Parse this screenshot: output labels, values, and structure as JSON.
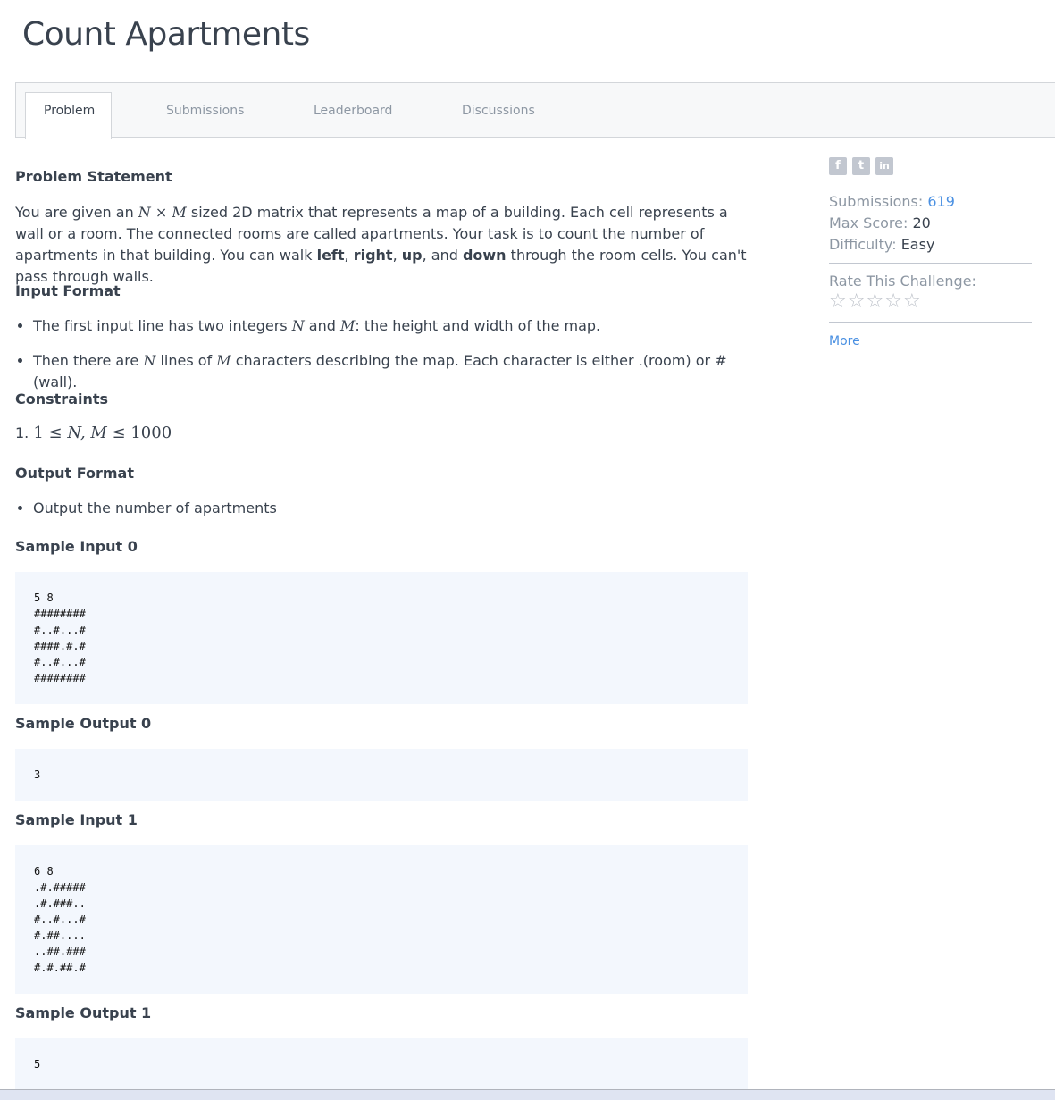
{
  "title": "Count Apartments",
  "tabs": [
    "Problem",
    "Submissions",
    "Leaderboard",
    "Discussions"
  ],
  "statement": {
    "heading": "Problem Statement",
    "p1": [
      "You are given an ",
      "N × M",
      " sized 2D matrix that represents a map of a building. Each cell represents a wall or a room. The connected rooms are called apartments. Your task is to count the number of apartments in that building. You can walk ",
      "left",
      ", ",
      "right",
      ", ",
      "up",
      ", and ",
      "down",
      " through the room cells. You can't pass through walls."
    ],
    "input_heading": "Input Format",
    "input_items": [
      [
        "The first input line has two integers ",
        "N",
        " and ",
        "M",
        ": the height and width of the map."
      ],
      [
        "Then there are ",
        "N",
        " lines of ",
        "M",
        " characters describing the map. Each character is either .(room) or #(wall)."
      ]
    ],
    "constraints_heading": "Constraints",
    "constraint": [
      "1. ",
      "1 ≤ ",
      "N, M",
      " ≤ 1000"
    ],
    "output_heading": "Output Format",
    "output_item": "Output the number of apartments",
    "samples": [
      {
        "label": "Sample Input 0",
        "text": "5 8\n########\n#..#...#\n####.#.#\n#..#...#\n########"
      },
      {
        "label": "Sample Output 0",
        "text": "3"
      },
      {
        "label": "Sample Input 1",
        "text": "6 8\n.#.#####\n.#.###..\n#..#...#\n#.##....\n..##.###\n#.#.##.#"
      },
      {
        "label": "Sample Output 1",
        "text": "5"
      }
    ]
  },
  "sidebar": {
    "social": [
      "f",
      "t",
      "in"
    ],
    "submissions_label": "Submissions:",
    "submissions": "619",
    "max_score_label": "Max Score:",
    "max_score": "20",
    "difficulty_label": "Difficulty:",
    "difficulty": "Easy",
    "rate_label": "Rate This Challenge:",
    "rating": 0,
    "rating_max": 5,
    "more": "More"
  },
  "colors": {
    "accent": "#4a90e2",
    "code_bg": "#f3f7fd"
  }
}
